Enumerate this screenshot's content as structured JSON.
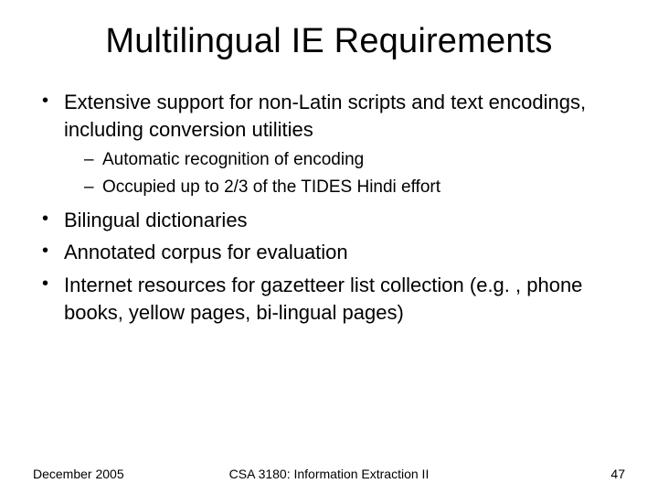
{
  "title": "Multilingual IE Requirements",
  "bullets": [
    {
      "text": "Extensive support for non-Latin scripts and text encodings, including conversion utilities",
      "sub": [
        "Automatic recognition of encoding",
        "Occupied up to 2/3 of the TIDES Hindi effort"
      ]
    },
    {
      "text": "Bilingual dictionaries"
    },
    {
      "text": "Annotated corpus for evaluation"
    },
    {
      "text": "Internet resources for gazetteer list collection (e.g. , phone books, yellow pages, bi-lingual pages)"
    }
  ],
  "footer": {
    "left": "December 2005",
    "center": "CSA 3180: Information Extraction II",
    "right": "47"
  }
}
